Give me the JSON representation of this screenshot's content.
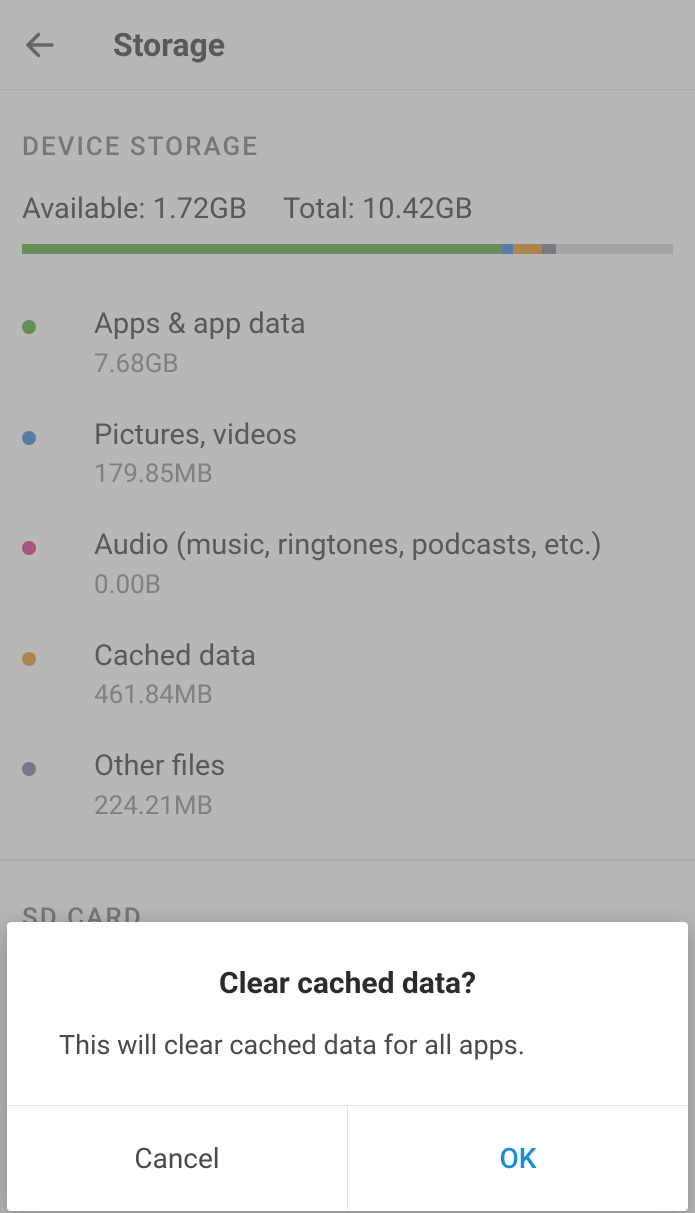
{
  "appbar": {
    "title": "Storage"
  },
  "section_device": {
    "header": "DEVICE STORAGE",
    "available_label": "Available: ",
    "available_value": "1.72GB",
    "total_label": "Total: ",
    "total_value": "10.42GB",
    "total_gb": 10.42,
    "categories": [
      {
        "name": "Apps & app data",
        "size": "7.68GB",
        "bytes": 7680000000,
        "color": "#4aa02c"
      },
      {
        "name": "Pictures, videos",
        "size": "179.85MB",
        "bytes": 179850000,
        "color": "#2a7ccf"
      },
      {
        "name": "Audio (music, ringtones, podcasts, etc.)",
        "size": "0.00B",
        "bytes": 0,
        "color": "#d6246a"
      },
      {
        "name": "Cached data",
        "size": "461.84MB",
        "bytes": 461840000,
        "color": "#e28a1b"
      },
      {
        "name": "Other files",
        "size": "224.21MB",
        "bytes": 224210000,
        "color": "#6f7383"
      }
    ]
  },
  "section_next": {
    "header": "SD CARD"
  },
  "dialog": {
    "title": "Clear cached data?",
    "message": "This will clear cached data for all apps.",
    "cancel": "Cancel",
    "ok": "OK"
  }
}
